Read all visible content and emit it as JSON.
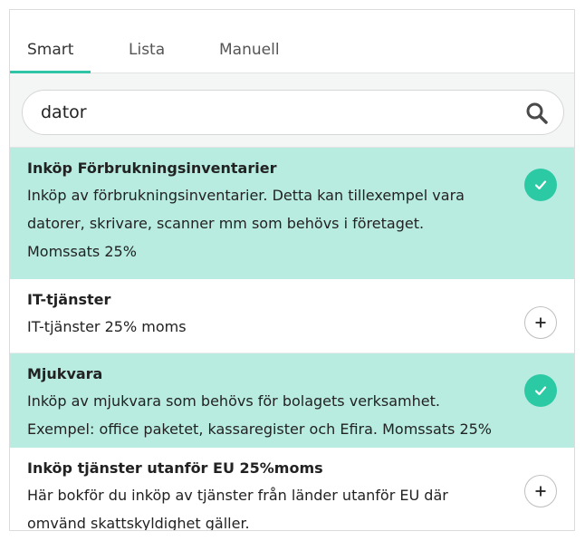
{
  "colors": {
    "accent": "#2ec4a5",
    "selected_bg": "#b8ece0",
    "check": "#2cc9a5"
  },
  "tabs": [
    {
      "label": "Smart",
      "active": true
    },
    {
      "label": "Lista",
      "active": false
    },
    {
      "label": "Manuell",
      "active": false
    }
  ],
  "search": {
    "value": "dator",
    "icon": "search-icon"
  },
  "results": [
    {
      "title": "Inköp Förbrukningsinventarier",
      "lines": [
        "Inköp av förbrukningsinventarier. Detta kan tillexempel vara",
        "datorer, skrivare, scanner mm som behövs i företaget.",
        "Momssats 25%"
      ],
      "selected": true,
      "action_icon": "checkmark-icon"
    },
    {
      "title": "IT-tjänster",
      "lines": [
        "IT-tjänster 25% moms"
      ],
      "selected": false,
      "action_icon": "plus-icon"
    },
    {
      "title": "Mjukvara",
      "lines": [
        "Inköp av mjukvara som behövs för bolagets verksamhet.",
        "Exempel: office paketet, kassaregister och Efira. Momssats 25%"
      ],
      "selected": true,
      "action_icon": "checkmark-icon"
    },
    {
      "title": "Inköp tjänster utanför EU 25%moms",
      "lines": [
        "Här bokför du inköp av tjänster från länder utanför EU där",
        "omvänd skattskyldighet gäller."
      ],
      "selected": false,
      "action_icon": "plus-icon"
    }
  ]
}
